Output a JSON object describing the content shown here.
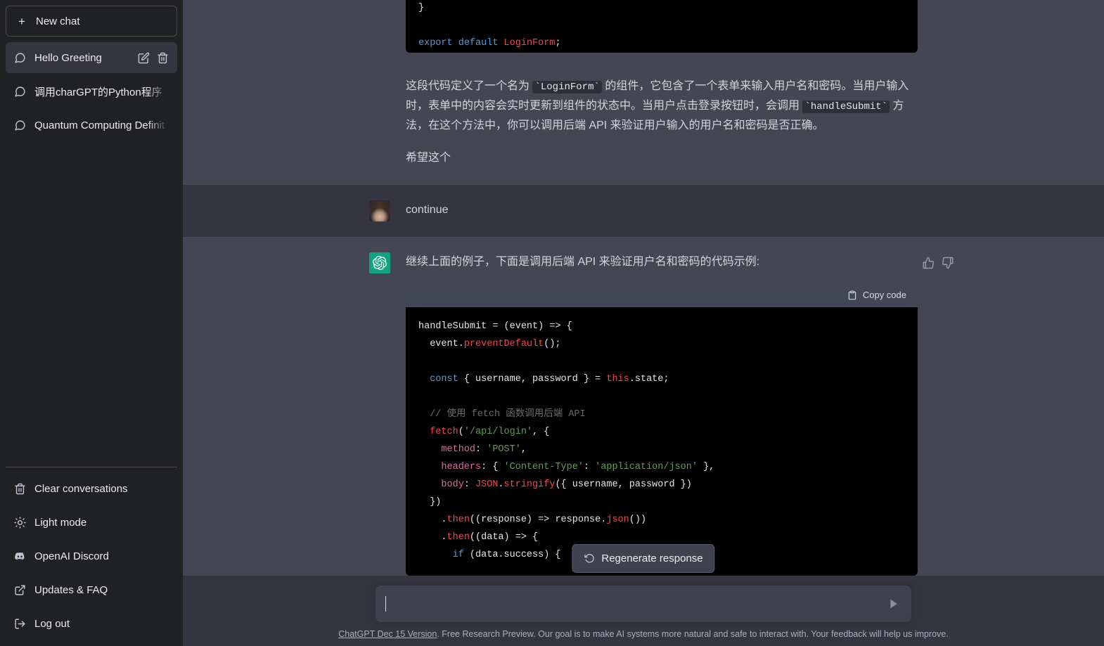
{
  "sidebar": {
    "new_chat_label": "New chat",
    "new_chat_icon": "plus-icon",
    "conversations": [
      {
        "label": "Hello Greeting",
        "icon": "message-icon",
        "active": true,
        "edit_icon": "pencil-icon",
        "delete_icon": "trash-icon"
      },
      {
        "label": "调用charGPT的Python程序",
        "icon": "message-icon",
        "active": false
      },
      {
        "label": "Quantum Computing Definit",
        "icon": "message-icon",
        "active": false
      }
    ],
    "footer_items": [
      {
        "label": "Clear conversations",
        "icon": "trash-icon"
      },
      {
        "label": "Light mode",
        "icon": "sun-icon"
      },
      {
        "label": "OpenAI Discord",
        "icon": "discord-icon"
      },
      {
        "label": "Updates & FAQ",
        "icon": "external-link-icon"
      },
      {
        "label": "Log out",
        "icon": "logout-icon"
      }
    ]
  },
  "thread": {
    "top_code_partial": {
      "line_brace": "}",
      "export_keyword": "export",
      "default_keyword": "default",
      "component_name": "LoginForm",
      "semicolon": ";"
    },
    "assistant_explanation": {
      "part1": "这段代码定义了一个名为 ",
      "code1": "LoginForm",
      "part2": " 的组件，它包含了一个表单来输入用户名和密码。当用户输入时，表单中的内容会实时更新到组件的状态中。当用户点击登录按钮时，会调用 ",
      "code2": "handleSubmit",
      "part3": " 方法，在这个方法中，你可以调用后端 API 来验证用户输入的用户名和密码是否正确。",
      "part4": "希望这个"
    },
    "user_message": {
      "text": "continue",
      "avatar": "user-avatar-photo"
    },
    "assistant_message": {
      "avatar": "chatgpt-logo-icon",
      "text": "继续上面的例子，下面是调用后端 API 来验证用户名和密码的代码示例:",
      "thumbs_up_icon": "thumbs-up-icon",
      "thumbs_down_icon": "thumbs-down-icon"
    },
    "code_block": {
      "copy_label": "Copy code",
      "copy_icon": "clipboard-icon",
      "lines": [
        {
          "t": "handleSubmit = (event) => {"
        },
        {
          "t": "  event."
        },
        {
          "t": "preventDefault",
          "c": "fn"
        },
        {
          "t": "();"
        },
        {
          "t": ""
        },
        {
          "t": "  const { username, password } = this.state;"
        },
        {
          "t": ""
        },
        {
          "t": "  // 使用 fetch 函数调用后端 API"
        },
        {
          "t": "  fetch('/api/login', {"
        },
        {
          "t": "    method: 'POST',"
        },
        {
          "t": "    headers: { 'Content-Type': 'application/json' },"
        },
        {
          "t": "    body: JSON.stringify({ username, password })"
        },
        {
          "t": "  })"
        },
        {
          "t": "    .then((response) => response.json())"
        },
        {
          "t": "    .then((data) => {"
        },
        {
          "t": "      if (data.success) {"
        }
      ]
    }
  },
  "regenerate": {
    "label": "Regenerate response",
    "icon": "refresh-icon"
  },
  "composer": {
    "value": "",
    "placeholder": "",
    "send_icon": "send-icon"
  },
  "footer": {
    "link_text": "ChatGPT Dec 15 Version",
    "rest_text": ". Free Research Preview. Our goal is to make AI systems more natural and safe to interact with. Your feedback will help us improve."
  },
  "colors": {
    "sidebar_bg": "#202123",
    "user_row_bg": "#343541",
    "assistant_row_bg": "#444654",
    "brand_green": "#10a37f",
    "code_bg": "#000000",
    "code_head_bg": "#434654"
  }
}
